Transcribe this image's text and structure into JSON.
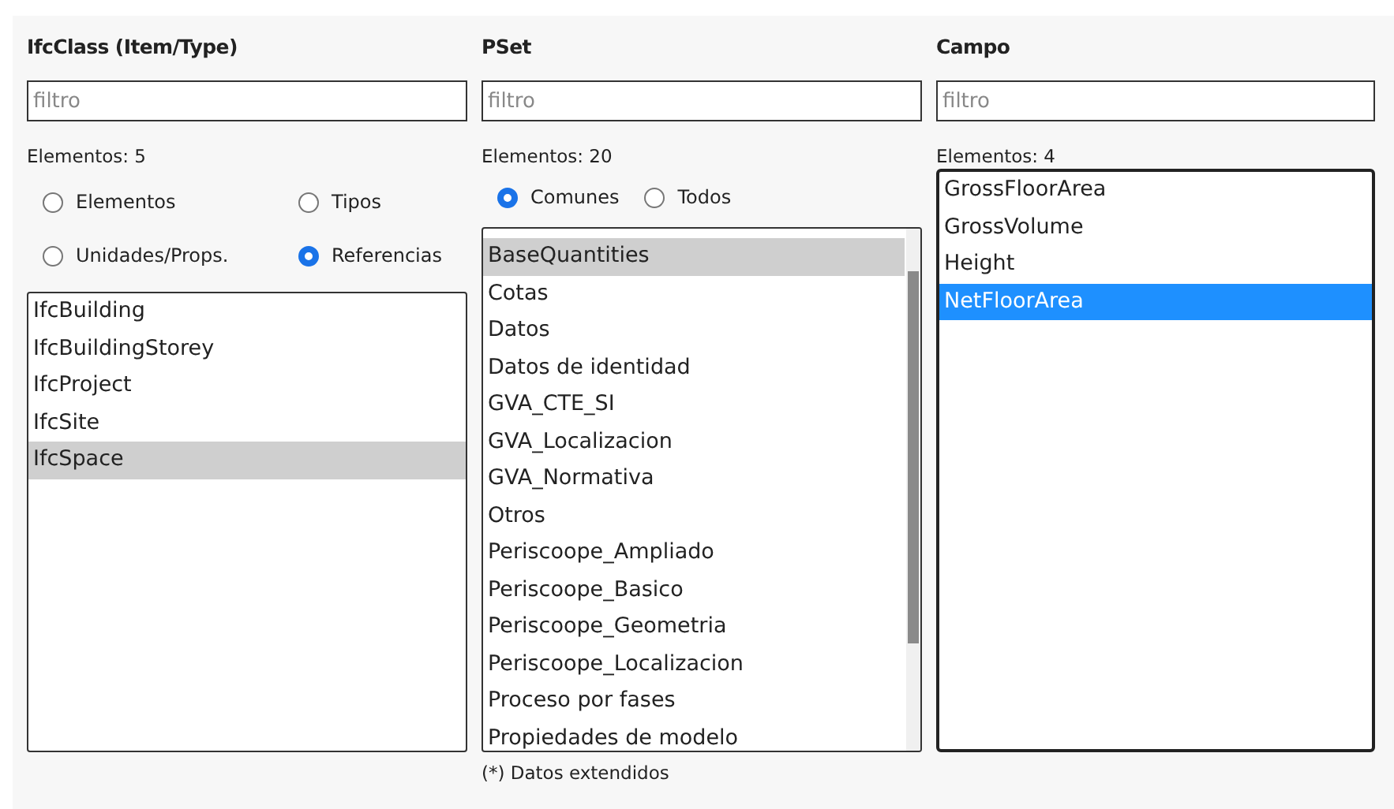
{
  "columns": [
    {
      "title": "IfcClass (Item/Type)",
      "filter": {
        "placeholder": "filtro"
      },
      "count": "Elementos: 5",
      "radios": [
        {
          "label": "Elementos",
          "selected": false
        },
        {
          "label": "Tipos",
          "selected": false
        },
        {
          "label": "Unidades/Props.",
          "selected": false
        },
        {
          "label": "Referencias",
          "selected": true
        }
      ],
      "items": [
        {
          "label": "IfcBuilding",
          "selected": false
        },
        {
          "label": "IfcBuildingStorey",
          "selected": false
        },
        {
          "label": "IfcProject",
          "selected": false
        },
        {
          "label": "IfcSite",
          "selected": false
        },
        {
          "label": "IfcSpace",
          "selected": true
        }
      ],
      "focused": false
    },
    {
      "title": "PSet",
      "filter": {
        "placeholder": "filtro"
      },
      "count": "Elementos: 20",
      "radios": [
        {
          "label": "Comunes",
          "selected": true
        },
        {
          "label": "Todos",
          "selected": false
        }
      ],
      "items": [
        {
          "label": "BaseQuantities",
          "selected": true
        },
        {
          "label": "Cotas",
          "selected": false
        },
        {
          "label": "Datos",
          "selected": false
        },
        {
          "label": "Datos de identidad",
          "selected": false
        },
        {
          "label": "GVA_CTE_SI",
          "selected": false
        },
        {
          "label": "GVA_Localizacion",
          "selected": false
        },
        {
          "label": "GVA_Normativa",
          "selected": false
        },
        {
          "label": "Otros",
          "selected": false
        },
        {
          "label": "Periscoope_Ampliado",
          "selected": false
        },
        {
          "label": "Periscoope_Basico",
          "selected": false
        },
        {
          "label": "Periscoope_Geometria",
          "selected": false
        },
        {
          "label": "Periscoope_Localizacion",
          "selected": false
        },
        {
          "label": "Proceso por fases",
          "selected": false
        },
        {
          "label": "Propiedades de modelo",
          "selected": false
        }
      ],
      "footnote": "(*) Datos extendidos",
      "focused": false
    },
    {
      "title": "Campo",
      "filter": {
        "placeholder": "filtro"
      },
      "count": "Elementos: 4",
      "items": [
        {
          "label": "GrossFloorArea",
          "selected": false
        },
        {
          "label": "GrossVolume",
          "selected": false
        },
        {
          "label": "Height",
          "selected": false
        },
        {
          "label": "NetFloorArea",
          "selected": true
        }
      ],
      "focused": true
    }
  ]
}
